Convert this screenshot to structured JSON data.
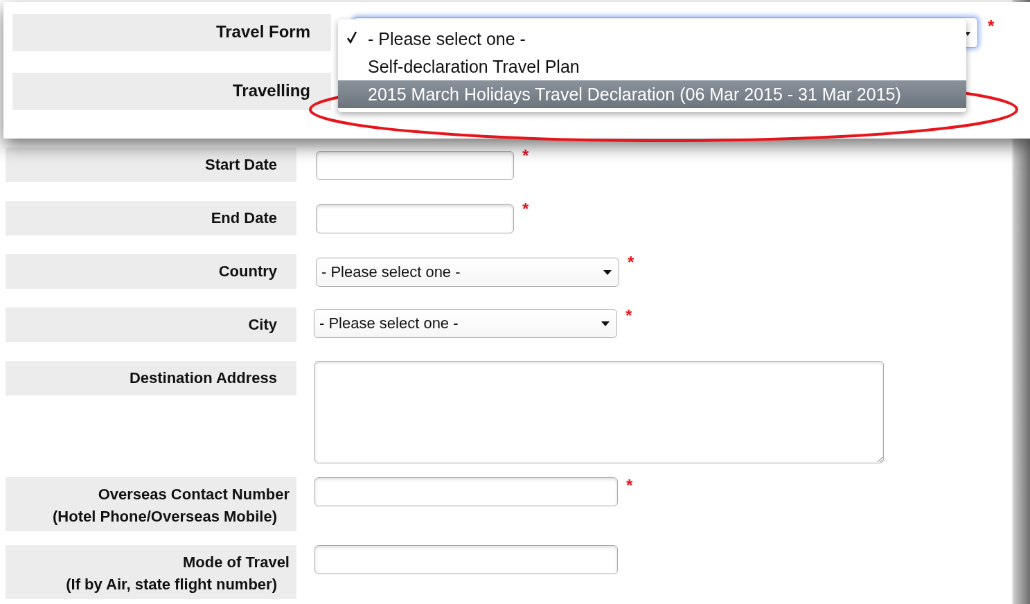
{
  "travel_form": {
    "label": "Travel Form",
    "required_mark": "*",
    "options": [
      {
        "label": "- Please select one -",
        "checked": true,
        "selected": false
      },
      {
        "label": "Self-declaration Travel Plan",
        "checked": false,
        "selected": false
      },
      {
        "label": "2015 March Holidays Travel Declaration (06 Mar 2015 - 31 Mar 2015)",
        "checked": false,
        "selected": true
      }
    ]
  },
  "travelling": {
    "label": "Travelling"
  },
  "fields": [
    {
      "kind": "text",
      "label": "Start Date",
      "required_mark": "*"
    },
    {
      "kind": "text",
      "label": "End Date",
      "required_mark": "*"
    },
    {
      "kind": "select",
      "label": "Country",
      "value": "- Please select one -",
      "required_mark": "*"
    },
    {
      "kind": "select",
      "label": "City",
      "value": "- Please select one -",
      "required_mark": "*"
    },
    {
      "kind": "textarea",
      "label": "Destination Address"
    },
    {
      "kind": "wide_text",
      "label": "Overseas Contact Number",
      "sublabel": "(Hotel Phone/Overseas Mobile)",
      "required_mark": "*"
    },
    {
      "kind": "wide_text",
      "label": "Mode of Travel",
      "sublabel": "(If by Air, state flight number)"
    }
  ]
}
